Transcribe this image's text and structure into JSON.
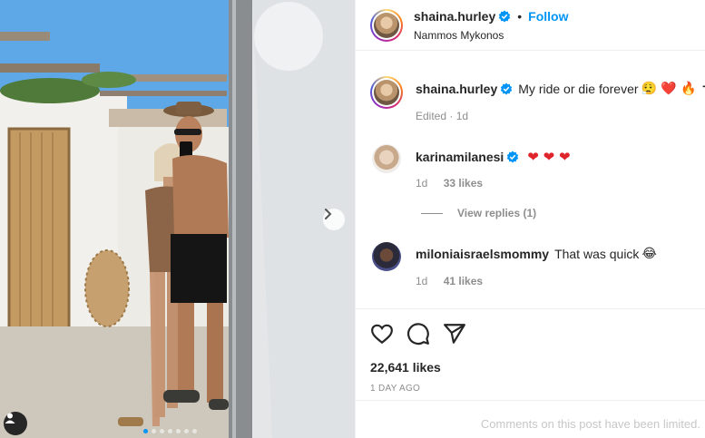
{
  "post": {
    "author": "shaina.hurley",
    "location": "Nammos Mykonos",
    "follow_label": "Follow",
    "header_separator": "•",
    "carousel_count": 7,
    "carousel_active": 0
  },
  "caption": {
    "username": "shaina.hurley",
    "text": "My ride or die forever",
    "emoji": "😮‍💨 ❤️ 🔥 ✝",
    "edited": "Edited",
    "age": "1d"
  },
  "comments": [
    {
      "username": "karinamilanesi",
      "text": "",
      "emoji": "❤ ❤ ❤",
      "age": "1d",
      "likes": "33 likes",
      "view_replies": "View replies (1)"
    },
    {
      "username": "miloniaisraelsmommy",
      "text": "That was quick",
      "emoji": "😂",
      "age": "1d",
      "likes": "41 likes"
    }
  ],
  "footer": {
    "likes": "22,641 likes",
    "time_ago": "1 DAY AGO",
    "limited_notice": "Comments on this post have been limited."
  },
  "colors": {
    "accent": "#0095f6",
    "verified": "#0095f6",
    "heart": "#e0242b",
    "muted": "#8e8e8e"
  },
  "icons": [
    "next-arrow-icon",
    "user-tag-icon",
    "verified-badge-icon",
    "heart-icon",
    "comment-icon",
    "share-icon"
  ]
}
